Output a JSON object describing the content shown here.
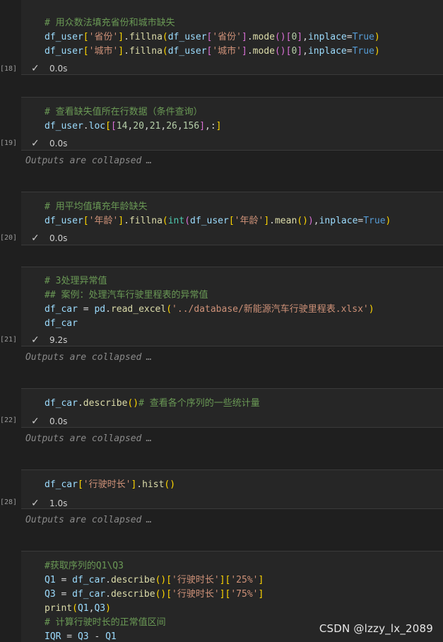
{
  "cells": [
    {
      "exec": "[18]",
      "status_time": "0.0s",
      "lines": [
        [
          [
            "tok-comment",
            "# 用众数法填充省份和城市缺失"
          ]
        ],
        [
          [
            "tok-var",
            "df_user"
          ],
          [
            "tok-br2",
            "["
          ],
          [
            "tok-str",
            "'省份'"
          ],
          [
            "tok-br2",
            "]"
          ],
          [
            "tok-punc",
            "."
          ],
          [
            "tok-func",
            "fillna"
          ],
          [
            "tok-br2",
            "("
          ],
          [
            "tok-var",
            "df_user"
          ],
          [
            "tok-br",
            "["
          ],
          [
            "tok-str",
            "'省份'"
          ],
          [
            "tok-br",
            "]"
          ],
          [
            "tok-punc",
            "."
          ],
          [
            "tok-func",
            "mode"
          ],
          [
            "tok-br",
            "()"
          ],
          [
            "tok-br",
            "["
          ],
          [
            "tok-num",
            "0"
          ],
          [
            "tok-br",
            "]"
          ],
          [
            "tok-punc",
            ","
          ],
          [
            "tok-var",
            "inplace"
          ],
          [
            "tok-op",
            "="
          ],
          [
            "tok-kw",
            "True"
          ],
          [
            "tok-br2",
            ")"
          ]
        ],
        [
          [
            "tok-var",
            "df_user"
          ],
          [
            "tok-br2",
            "["
          ],
          [
            "tok-str",
            "'城市'"
          ],
          [
            "tok-br2",
            "]"
          ],
          [
            "tok-punc",
            "."
          ],
          [
            "tok-func",
            "fillna"
          ],
          [
            "tok-br2",
            "("
          ],
          [
            "tok-var",
            "df_user"
          ],
          [
            "tok-br",
            "["
          ],
          [
            "tok-str",
            "'城市'"
          ],
          [
            "tok-br",
            "]"
          ],
          [
            "tok-punc",
            "."
          ],
          [
            "tok-func",
            "mode"
          ],
          [
            "tok-br",
            "()"
          ],
          [
            "tok-br",
            "["
          ],
          [
            "tok-num",
            "0"
          ],
          [
            "tok-br",
            "]"
          ],
          [
            "tok-punc",
            ","
          ],
          [
            "tok-var",
            "inplace"
          ],
          [
            "tok-op",
            "="
          ],
          [
            "tok-kw",
            "True"
          ],
          [
            "tok-br2",
            ")"
          ]
        ]
      ]
    },
    {
      "exec": "[19]",
      "status_time": "0.0s",
      "collapsed": "Outputs are collapsed",
      "lines": [
        [
          [
            "tok-comment",
            "# 查看缺失值所在行数据（条件查询）"
          ]
        ],
        [
          [
            "tok-var",
            "df_user"
          ],
          [
            "tok-punc",
            "."
          ],
          [
            "tok-var",
            "loc"
          ],
          [
            "tok-br2",
            "["
          ],
          [
            "tok-br",
            "["
          ],
          [
            "tok-num",
            "14"
          ],
          [
            "tok-punc",
            ","
          ],
          [
            "tok-num",
            "20"
          ],
          [
            "tok-punc",
            ","
          ],
          [
            "tok-num",
            "21"
          ],
          [
            "tok-punc",
            ","
          ],
          [
            "tok-num",
            "26"
          ],
          [
            "tok-punc",
            ","
          ],
          [
            "tok-num",
            "156"
          ],
          [
            "tok-br",
            "]"
          ],
          [
            "tok-punc",
            ",:"
          ],
          [
            "tok-br2",
            "]"
          ]
        ]
      ]
    },
    {
      "exec": "[20]",
      "status_time": "0.0s",
      "lines": [
        [
          [
            "tok-comment",
            "# 用平均值填充年龄缺失"
          ]
        ],
        [
          [
            "tok-var",
            "df_user"
          ],
          [
            "tok-br2",
            "["
          ],
          [
            "tok-str",
            "'年龄'"
          ],
          [
            "tok-br2",
            "]"
          ],
          [
            "tok-punc",
            "."
          ],
          [
            "tok-func",
            "fillna"
          ],
          [
            "tok-br2",
            "("
          ],
          [
            "tok-int",
            "int"
          ],
          [
            "tok-br",
            "("
          ],
          [
            "tok-var",
            "df_user"
          ],
          [
            "tok-br2",
            "["
          ],
          [
            "tok-str",
            "'年龄'"
          ],
          [
            "tok-br2",
            "]"
          ],
          [
            "tok-punc",
            "."
          ],
          [
            "tok-func",
            "mean"
          ],
          [
            "tok-br2",
            "()"
          ],
          [
            "tok-br",
            ")"
          ],
          [
            "tok-punc",
            ","
          ],
          [
            "tok-var",
            "inplace"
          ],
          [
            "tok-op",
            "="
          ],
          [
            "tok-kw",
            "True"
          ],
          [
            "tok-br2",
            ")"
          ]
        ]
      ]
    },
    {
      "exec": "[21]",
      "status_time": "9.2s",
      "collapsed": "Outputs are collapsed",
      "lines": [
        [
          [
            "tok-comment",
            "# 3处理异常值"
          ]
        ],
        [
          [
            "tok-comment",
            "## 案例：处理汽车行驶里程表的异常值"
          ]
        ],
        [
          [
            "tok-var",
            "df_car"
          ],
          [
            "tok-op",
            " = "
          ],
          [
            "tok-var",
            "pd"
          ],
          [
            "tok-punc",
            "."
          ],
          [
            "tok-func",
            "read_excel"
          ],
          [
            "tok-br2",
            "("
          ],
          [
            "tok-str",
            "'../database/新能源汽车行驶里程表.xlsx'"
          ],
          [
            "tok-br2",
            ")"
          ]
        ],
        [
          [
            "tok-var",
            "df_car"
          ]
        ]
      ]
    },
    {
      "exec": "[22]",
      "status_time": "0.0s",
      "collapsed": "Outputs are collapsed",
      "lines": [
        [
          [
            "tok-var",
            "df_car"
          ],
          [
            "tok-punc",
            "."
          ],
          [
            "tok-func",
            "describe"
          ],
          [
            "tok-br2",
            "()"
          ],
          [
            "tok-comment",
            "# 查看各个序列的一些统计量"
          ]
        ]
      ]
    },
    {
      "exec": "[28]",
      "status_time": "1.0s",
      "collapsed": "Outputs are collapsed",
      "lines": [
        [
          [
            "tok-var",
            "df_car"
          ],
          [
            "tok-br2",
            "["
          ],
          [
            "tok-str",
            "'行驶时长'"
          ],
          [
            "tok-br2",
            "]"
          ],
          [
            "tok-punc",
            "."
          ],
          [
            "tok-func",
            "hist"
          ],
          [
            "tok-br2",
            "()"
          ]
        ]
      ]
    },
    {
      "exec": "",
      "status_time": "",
      "lines": [
        [
          [
            "tok-comment",
            "#获取序列的Q1\\Q3"
          ]
        ],
        [
          [
            "tok-var",
            "Q1"
          ],
          [
            "tok-op",
            " = "
          ],
          [
            "tok-var",
            "df_car"
          ],
          [
            "tok-punc",
            "."
          ],
          [
            "tok-func",
            "describe"
          ],
          [
            "tok-br2",
            "()"
          ],
          [
            "tok-br2",
            "["
          ],
          [
            "tok-str",
            "'行驶时长'"
          ],
          [
            "tok-br2",
            "]"
          ],
          [
            "tok-br2",
            "["
          ],
          [
            "tok-str",
            "'25%'"
          ],
          [
            "tok-br2",
            "]"
          ]
        ],
        [
          [
            "tok-var",
            "Q3"
          ],
          [
            "tok-op",
            " = "
          ],
          [
            "tok-var",
            "df_car"
          ],
          [
            "tok-punc",
            "."
          ],
          [
            "tok-func",
            "describe"
          ],
          [
            "tok-br2",
            "()"
          ],
          [
            "tok-br2",
            "["
          ],
          [
            "tok-str",
            "'行驶时长'"
          ],
          [
            "tok-br2",
            "]"
          ],
          [
            "tok-br2",
            "["
          ],
          [
            "tok-str",
            "'75%'"
          ],
          [
            "tok-br2",
            "]"
          ]
        ],
        [
          [
            "tok-func",
            "print"
          ],
          [
            "tok-br2",
            "("
          ],
          [
            "tok-var",
            "Q1"
          ],
          [
            "tok-punc",
            ","
          ],
          [
            "tok-var",
            "Q3"
          ],
          [
            "tok-br2",
            ")"
          ]
        ],
        [
          [
            "tok-comment",
            "# 计算行驶时长的正常值区间"
          ]
        ],
        [
          [
            "tok-var",
            "IQR"
          ],
          [
            "tok-op",
            " = "
          ],
          [
            "tok-var",
            "Q3"
          ],
          [
            "tok-op",
            " - "
          ],
          [
            "tok-var",
            "Q1"
          ]
        ]
      ]
    }
  ],
  "icons": {
    "status_check": "check-icon"
  },
  "check_glyph": "✓",
  "dots_glyph": "…",
  "watermark": "CSDN @lzzy_lx_2089"
}
